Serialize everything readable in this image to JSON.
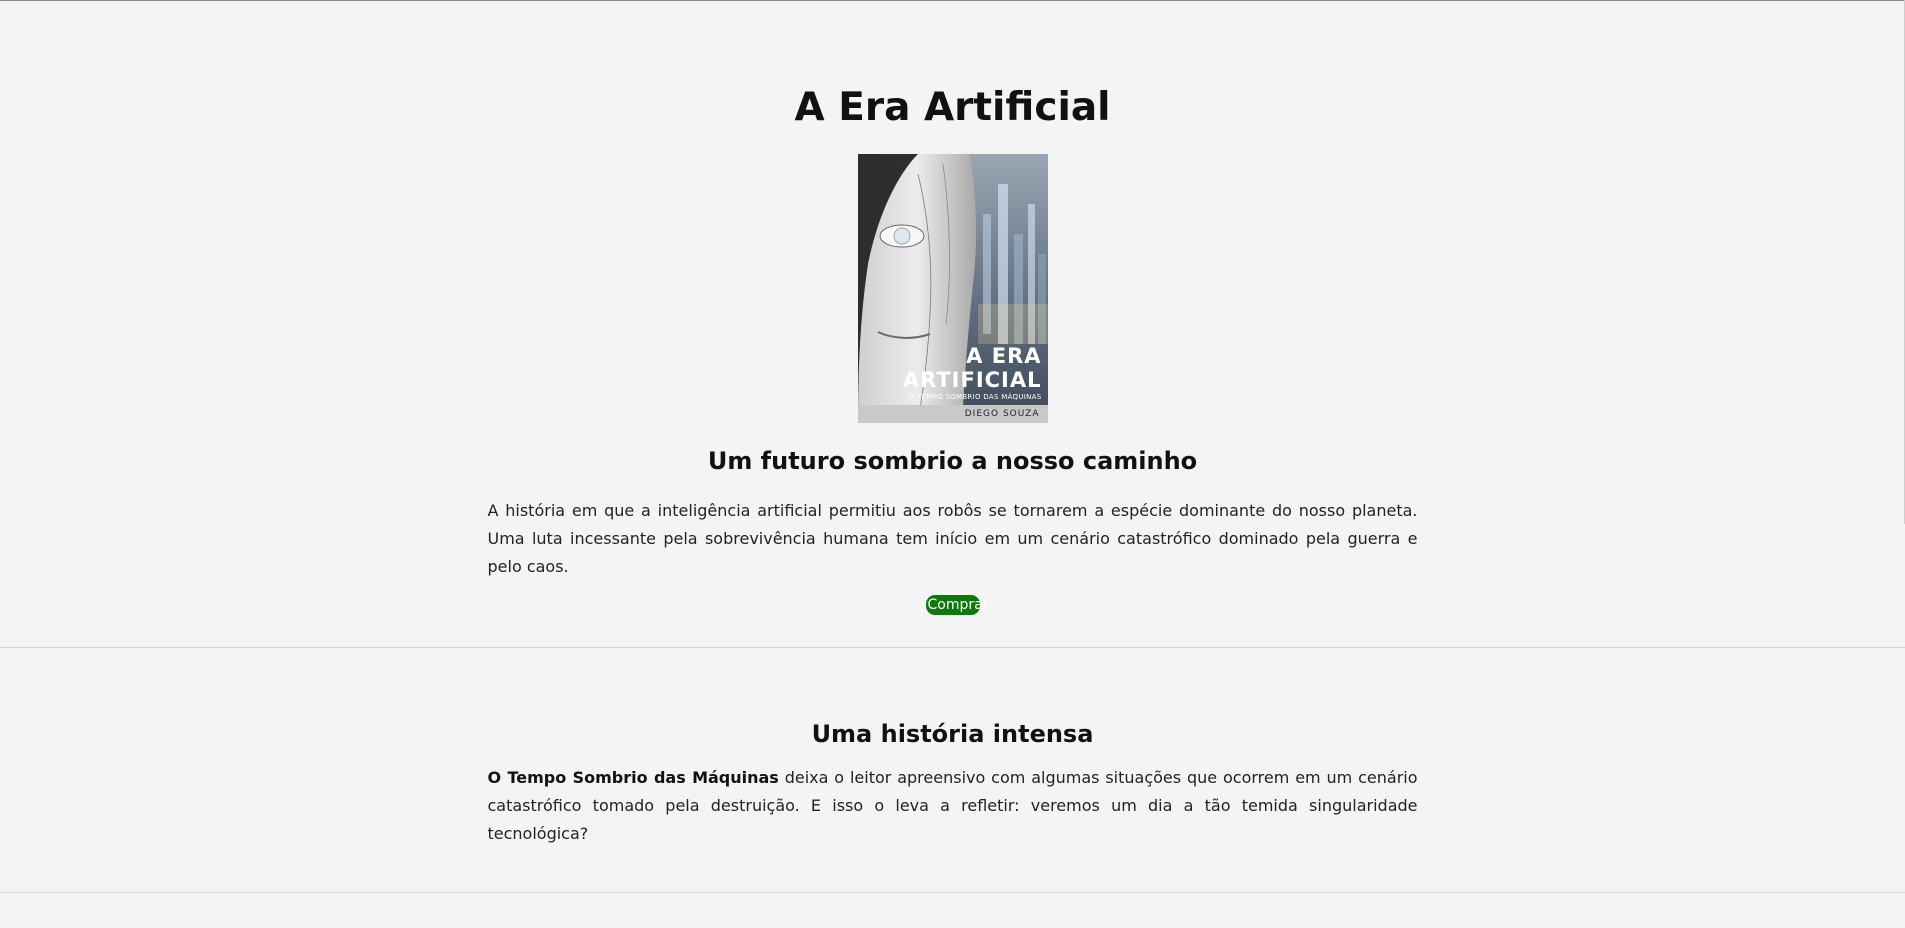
{
  "hero": {
    "title": "A Era Artificial",
    "cover": {
      "title_line_1": "A ERA",
      "title_line_2": "ARTIFICIAL",
      "subtitle": "O TEMPO SOMBRIO DAS MÁQUINAS",
      "author": "DIEGO SOUZA"
    },
    "heading": "Um futuro sombrio a nosso caminho",
    "description": "A história em que a inteligência artificial permitiu aos robôs se tornarem a espécie dominante do nosso planeta. Uma luta incessante pela sobrevivência humana tem início em um cenário catastrófico dominado pela guerra e pelo caos.",
    "buy_label": "Comprar",
    "buy_color": "#0b7a0b"
  },
  "story": {
    "heading": "Uma história intensa",
    "bold_lead": "O Tempo Sombrio das Máquinas",
    "text": " deixa o leitor apreensivo com algumas situações que ocorrem em um cenário catastrófico tomado pela destruição. E isso o leva a refletir: veremos um dia a tão temida singularidade tecnológica?"
  },
  "colors": {
    "background": "#f4f4f4",
    "text": "#111111",
    "divider": "#d6d6d6"
  }
}
